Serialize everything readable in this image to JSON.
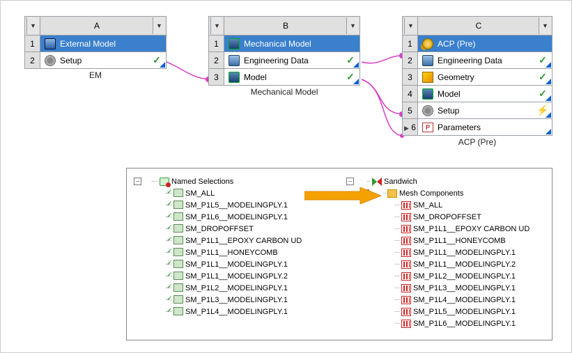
{
  "systems": {
    "em": {
      "letter": "A",
      "caption": "EM",
      "rows": [
        {
          "num": "1",
          "icon": "cube",
          "label": "External Model",
          "status": "",
          "selected": true
        },
        {
          "num": "2",
          "icon": "gear",
          "label": "Setup",
          "status": "check",
          "selected": false
        }
      ]
    },
    "mm": {
      "letter": "B",
      "caption": "Mechanical Model",
      "rows": [
        {
          "num": "1",
          "icon": "cube-drk",
          "label": "Mechanical Model",
          "status": "",
          "selected": true
        },
        {
          "num": "2",
          "icon": "book",
          "label": "Engineering Data",
          "status": "check",
          "selected": false
        },
        {
          "num": "3",
          "icon": "cube-drk",
          "label": "Model",
          "status": "check",
          "selected": false
        }
      ]
    },
    "acp": {
      "letter": "C",
      "caption": "ACP (Pre)",
      "rows": [
        {
          "num": "1",
          "icon": "cogs",
          "label": "ACP (Pre)",
          "status": "",
          "selected": true
        },
        {
          "num": "2",
          "icon": "book",
          "label": "Engineering Data",
          "status": "check",
          "selected": false
        },
        {
          "num": "3",
          "icon": "geom",
          "label": "Geometry",
          "status": "check",
          "selected": false
        },
        {
          "num": "4",
          "icon": "cube-drk",
          "label": "Model",
          "status": "check",
          "selected": false
        },
        {
          "num": "5",
          "icon": "gear",
          "label": "Setup",
          "status": "bolt",
          "selected": false
        },
        {
          "num": "6",
          "icon": "param",
          "label": "Parameters",
          "status": "",
          "selected": false
        }
      ]
    }
  },
  "left_tree": {
    "root": "Named Selections",
    "items": [
      "SM_ALL",
      "SM_P1L5__MODELINGPLY.1",
      "SM_P1L6__MODELINGPLY.1",
      "SM_DROPOFFSET",
      "SM_P1L1__EPOXY CARBON UD",
      "SM_P1L1__HONEYCOMB",
      "SM_P1L1__MODELINGPLY.1",
      "SM_P1L1__MODELINGPLY.2",
      "SM_P1L2__MODELINGPLY.1",
      "SM_P1L3__MODELINGPLY.1",
      "SM_P1L4__MODELINGPLY.1"
    ]
  },
  "right_tree": {
    "root": "Sandwich",
    "sub": "Mesh Components",
    "items": [
      "SM_ALL",
      "SM_DROPOFFSET",
      "SM_P1L1__EPOXY CARBON UD",
      "SM_P1L1__HONEYCOMB",
      "SM_P1L1__MODELINGPLY.1",
      "SM_P1L1__MODELINGPLY.2",
      "SM_P1L2__MODELINGPLY.1",
      "SM_P1L3__MODELINGPLY.1",
      "SM_P1L4__MODELINGPLY.1",
      "SM_P1L5__MODELINGPLY.1",
      "SM_P1L6__MODELINGPLY.1"
    ]
  }
}
